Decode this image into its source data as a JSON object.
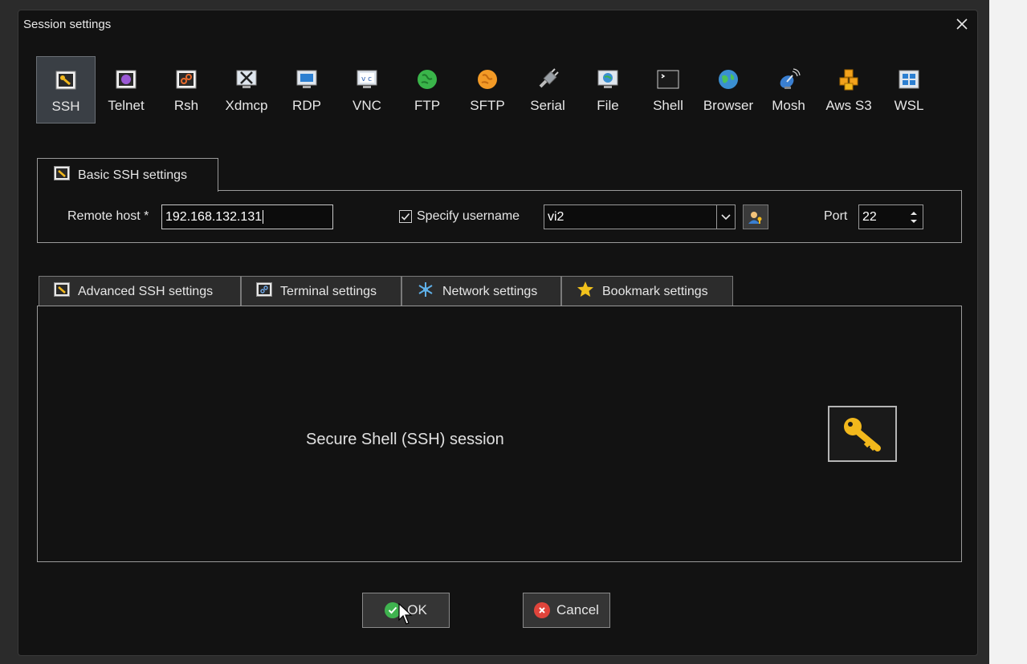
{
  "dialog": {
    "title": "Session settings"
  },
  "toolbar": {
    "items": [
      {
        "label": "SSH",
        "icon": "ssh-key-icon",
        "selected": true
      },
      {
        "label": "Telnet",
        "icon": "telnet-icon"
      },
      {
        "label": "Rsh",
        "icon": "rsh-icon"
      },
      {
        "label": "Xdmcp",
        "icon": "xdmcp-icon"
      },
      {
        "label": "RDP",
        "icon": "rdp-monitor-icon"
      },
      {
        "label": "VNC",
        "icon": "vnc-icon"
      },
      {
        "label": "FTP",
        "icon": "ftp-globe-icon"
      },
      {
        "label": "SFTP",
        "icon": "sftp-globe-icon"
      },
      {
        "label": "Serial",
        "icon": "serial-plug-icon"
      },
      {
        "label": "File",
        "icon": "file-monitor-icon"
      },
      {
        "label": "Shell",
        "icon": "shell-terminal-icon"
      },
      {
        "label": "Browser",
        "icon": "browser-globe-icon"
      },
      {
        "label": "Mosh",
        "icon": "mosh-satellite-icon"
      },
      {
        "label": "Aws S3",
        "icon": "aws-s3-cubes-icon"
      },
      {
        "label": "WSL",
        "icon": "wsl-windows-icon"
      }
    ]
  },
  "basic": {
    "tab_label": "Basic SSH settings",
    "remote_host_label": "Remote host *",
    "remote_host_value": "192.168.132.131",
    "specify_username_label": "Specify username",
    "specify_username_checked": true,
    "username_value": "vi2",
    "port_label": "Port",
    "port_value": "22"
  },
  "tabs": [
    {
      "label": "Advanced SSH settings",
      "icon": "wrench-icon"
    },
    {
      "label": "Terminal settings",
      "icon": "terminal-icon"
    },
    {
      "label": "Network settings",
      "icon": "network-icon"
    },
    {
      "label": "Bookmark settings",
      "icon": "star-icon"
    }
  ],
  "panel": {
    "description": "Secure Shell (SSH) session",
    "icon": "key-icon"
  },
  "buttons": {
    "ok_label": "OK",
    "cancel_label": "Cancel"
  },
  "colors": {
    "ok_green": "#3fb34f",
    "cancel_red": "#e0443b",
    "key_gold": "#f2b81c"
  }
}
